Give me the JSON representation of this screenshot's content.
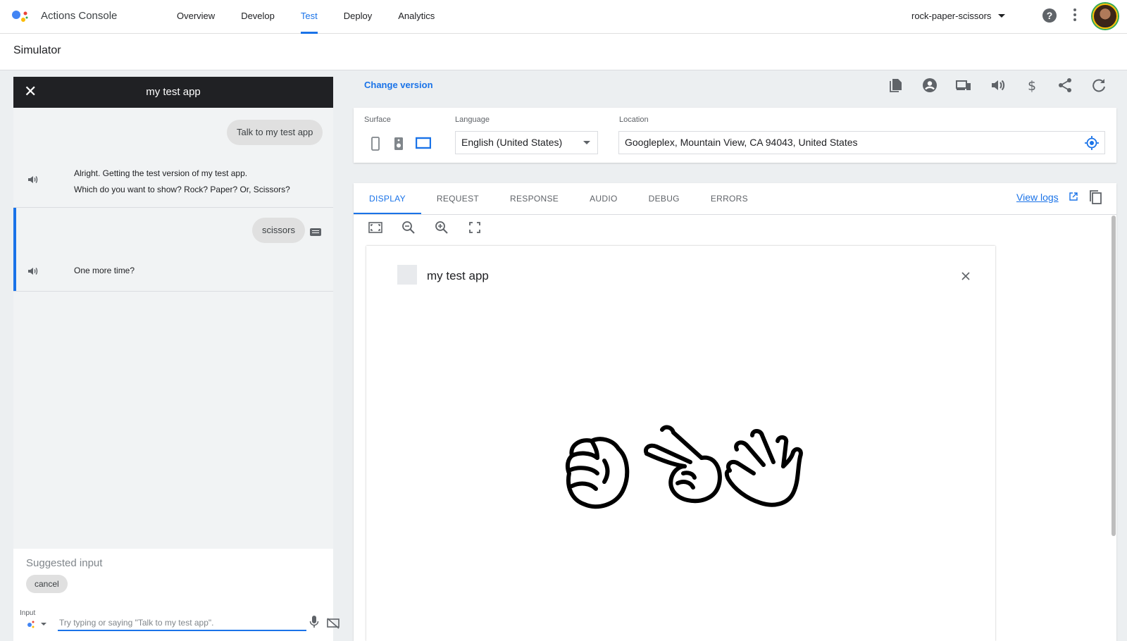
{
  "topbar": {
    "brand": "Actions Console",
    "nav": [
      "Overview",
      "Develop",
      "Test",
      "Deploy",
      "Analytics"
    ],
    "active_nav": "Test",
    "project": "rock-paper-scissors"
  },
  "page_title": "Simulator",
  "conversation": {
    "title": "my test app",
    "user_msg_1": "Talk to my test app",
    "bot_msg_1_line1": "Alright. Getting the test version of my test app.",
    "bot_msg_1_line2": "Which do you want to show? Rock? Paper? Or, Scissors?",
    "user_msg_2": "scissors",
    "bot_msg_2": "One more time?",
    "suggested_label": "Suggested input",
    "suggestions": [
      "cancel"
    ],
    "input_label": "Input",
    "input_placeholder": "Try typing or saying \"Talk to my test app\"."
  },
  "settings": {
    "change_version": "Change version",
    "surface_label": "Surface",
    "language_label": "Language",
    "language_value": "English (United States)",
    "location_label": "Location",
    "location_value": "Googleplex, Mountain View, CA 94043, United States"
  },
  "tabs": [
    "Display",
    "Request",
    "Response",
    "Audio",
    "Debug",
    "Errors"
  ],
  "active_tab": "Display",
  "view_logs": "View logs",
  "display": {
    "title": "my test app"
  },
  "colors": {
    "accent": "#1a73e8",
    "header_dark": "#202124"
  }
}
